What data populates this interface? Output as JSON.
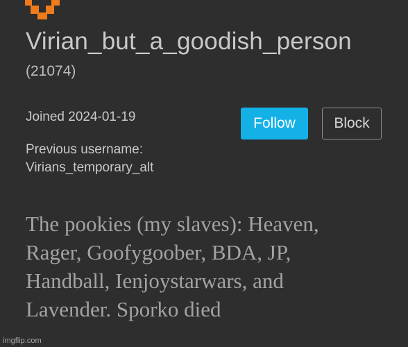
{
  "profile": {
    "avatar_icon": "pixel-avatar-icon",
    "avatar_color": "#f07b1b",
    "username": "Virian_but_a_goodish_person",
    "user_id": "(21074)",
    "joined": "Joined 2024-01-19",
    "previous_username_label": "Previous username:",
    "previous_username": "Virians_temporary_alt"
  },
  "actions": {
    "follow_label": "Follow",
    "block_label": "Block",
    "follow_color": "#14b1e7"
  },
  "bio": {
    "lines": [
      "The pookies (my slaves): Heaven,",
      "Rager, Goofygoober, BDA, JP,",
      "Handball, Ienjoystarwars, and",
      "Lavender. Sporko died"
    ]
  },
  "watermark": "imgflip.com"
}
